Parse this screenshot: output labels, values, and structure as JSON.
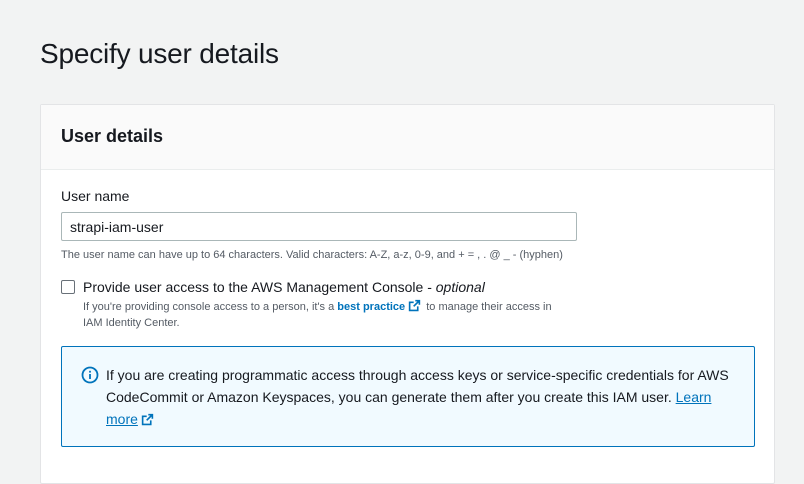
{
  "page": {
    "title": "Specify user details"
  },
  "section": {
    "title": "User details"
  },
  "user_name": {
    "label": "User name",
    "value": "strapi-iam-user",
    "constraint": "The user name can have up to 64 characters. Valid characters: A-Z, a-z, 0-9, and + = , . @ _ - (hyphen)"
  },
  "console_access": {
    "checked": false,
    "label": "Provide user access to the AWS Management Console - ",
    "optional": "optional",
    "desc_before": "If you're providing console access to a person, it's a ",
    "link_text": "best practice",
    "desc_after": " to manage their access in IAM Identity Center."
  },
  "info_alert": {
    "text": "If you are creating programmatic access through access keys or service-specific credentials for AWS CodeCommit or Amazon Keyspaces, you can generate them after you create this IAM user. ",
    "link_text": "Learn more"
  },
  "colors": {
    "link": "#0073bb",
    "alert_bg": "#f1faff",
    "alert_border": "#0073bb",
    "text": "#16191f",
    "muted": "#545b64"
  },
  "icons": {
    "info": "info-icon",
    "external": "external-link-icon"
  }
}
